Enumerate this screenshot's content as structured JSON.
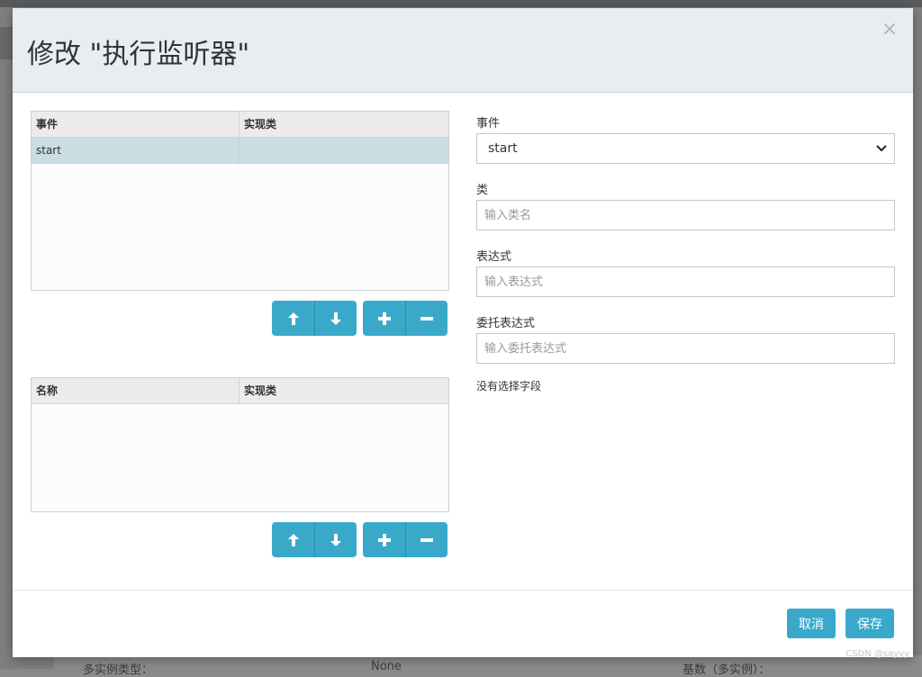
{
  "background": {
    "texts": [
      "多实例类型：",
      "None",
      "基数（多实例）："
    ]
  },
  "dialog": {
    "title": "修改 \"执行监听器\"",
    "close_glyph": "×"
  },
  "listeners_table": {
    "columns": [
      "事件",
      "实现类"
    ],
    "rows": [
      {
        "event": "start",
        "impl": ""
      }
    ]
  },
  "fields_table": {
    "columns": [
      "名称",
      "实现类"
    ],
    "rows": []
  },
  "icons": {
    "move_up": "arrow-up-icon",
    "move_down": "arrow-down-icon",
    "add": "plus-icon",
    "remove": "minus-icon"
  },
  "form": {
    "event_label": "事件",
    "event_value": "start",
    "class_label": "类",
    "class_placeholder": "输入类名",
    "expression_label": "表达式",
    "expression_placeholder": "输入表达式",
    "delegate_label": "委托表达式",
    "delegate_placeholder": "输入委托表达式",
    "no_field_selected": "没有选择字段"
  },
  "footer": {
    "cancel_label": "取消",
    "save_label": "保存"
  },
  "watermark": "CSDN @sayyy",
  "colors": {
    "accent": "#3aa9c9",
    "selected_row": "#c9dde2",
    "header_bg": "#e8edf1"
  }
}
